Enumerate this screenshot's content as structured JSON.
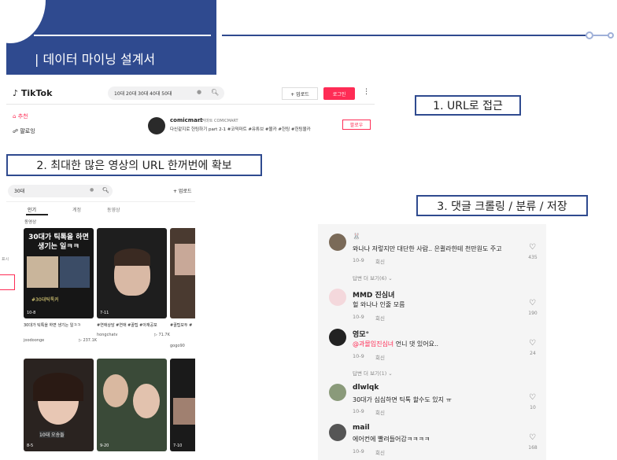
{
  "header": {
    "title": "| 데이터 마이닝 설계서"
  },
  "steps": {
    "step1": "1. URL로 접근",
    "step2": "2. 최대한 많은 영상의 URL 한꺼번에 확보",
    "step3": "3. 댓글 크롤링 / 분류 / 저장"
  },
  "tiktok_home": {
    "logo": "TikTok",
    "search_value": "10대 20대 30대 40대 50대",
    "upload_label": "+ 업로드",
    "login_label": "로그인",
    "more_icon": "⋮",
    "nav_for_you": "추천",
    "nav_following": "팔로잉",
    "username": "comicmart",
    "user_sub": "코믹마트 COMICMART",
    "description": "다신같지로 헌팅하기 part 2-1 #코믹마트 #유튜브 #몰카 #헌팅 #헌팅몰카",
    "follow_label": "팔로우"
  },
  "tiktok_search": {
    "search_value": "30대",
    "upload_label": "+ 업로드",
    "tabs": [
      "인기",
      "계정",
      "동영상"
    ],
    "section_label": "동영상",
    "left_label": "표시",
    "videos": [
      {
        "overlay": "30대가 틱톡을 하면 생기는 일ㅋㅋ",
        "count": "10-8",
        "caption": "30대가 틱톡을 하면 생기는 일ㅋㅋ",
        "user": "joodoonge",
        "views": "237.1K"
      },
      {
        "overlay": "",
        "count": "7-11",
        "caption": "#연애상담 #연애 #꿀팁 #아재공포",
        "user": "hongchatv",
        "views": "71.7K"
      },
      {
        "overlay": "",
        "count": "",
        "caption": "#꿀팁모두 #",
        "user": "gogo90",
        "views": ""
      },
      {
        "overlay": "10대 오송들",
        "count": "8-5",
        "caption": "",
        "user": "",
        "views": ""
      },
      {
        "overlay": "",
        "count": "9-20",
        "caption": "",
        "user": "",
        "views": ""
      },
      {
        "overlay": "",
        "count": "7-10",
        "caption": "",
        "user": "",
        "views": ""
      }
    ]
  },
  "comments": [
    {
      "name": "🐰",
      "text": "와나나 저렇지만 대단한 사람.. 은퀼라한테 천만원도 주고",
      "date": "10-9",
      "reply_label": "회신",
      "likes": "435",
      "more": "답변 더 보기(6) ⌄",
      "color": "#7a6a58"
    },
    {
      "name": "MMD 진심녀",
      "text": "헐 와나나 인줄 모름",
      "date": "10-9",
      "reply_label": "회신",
      "likes": "190",
      "more": "",
      "color": "#e8b4b8"
    },
    {
      "name": "영모°",
      "mention": "@과몰입진심녀",
      "text": " 언니 댓 있어요..",
      "date": "10-9",
      "reply_label": "회신",
      "likes": "24",
      "more": "답변 더 보기(1) ⌄",
      "color": "#222222"
    },
    {
      "name": "dlwlqk",
      "text": "30대가 심심하면 틱톡 할수도 있지 ㅠ",
      "date": "10-9",
      "reply_label": "회신",
      "likes": "10",
      "more": "",
      "color": "#8a9a7a"
    },
    {
      "name": "mail",
      "text": "에어컨에 빨려들어감ㅋㅋㅋㅋ",
      "date": "10-9",
      "reply_label": "회신",
      "likes": "168",
      "more": "",
      "color": "#555555"
    }
  ]
}
